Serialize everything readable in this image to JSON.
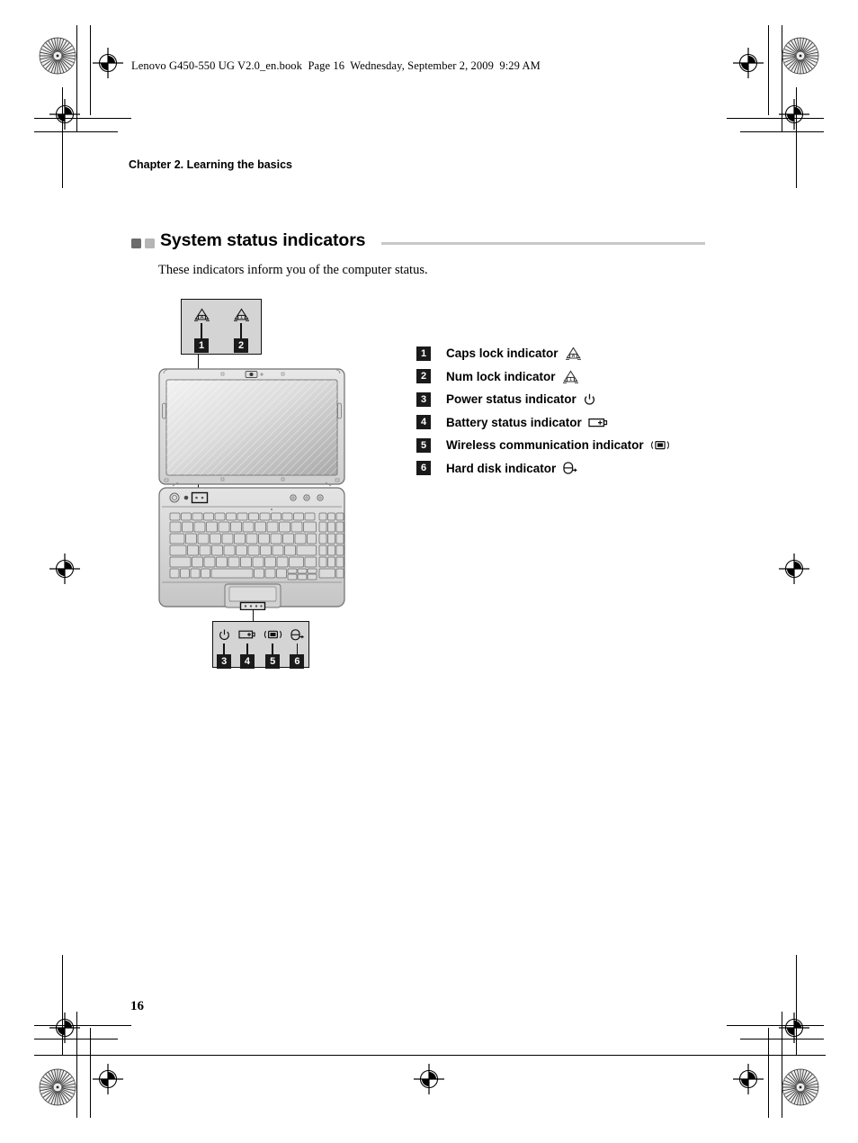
{
  "header": {
    "filename_line": "Lenovo G450-550 UG V2.0_en.book  Page 16  Wednesday, September 2, 2009  9:29 AM"
  },
  "chapter": {
    "title": "Chapter 2. Learning the basics"
  },
  "section": {
    "title": "System status indicators",
    "intro": "These indicators inform you of the computer status.",
    "bullet_dark_color": "#6b6b6b",
    "bullet_light_color": "#b5b5b5",
    "rule_color": "#c8c8c8"
  },
  "legend": {
    "items": [
      {
        "number": "1",
        "label": "Caps lock indicator",
        "icon": "caps-lock-icon"
      },
      {
        "number": "2",
        "label": "Num lock indicator",
        "icon": "num-lock-icon"
      },
      {
        "number": "3",
        "label": "Power status indicator",
        "icon": "power-icon"
      },
      {
        "number": "4",
        "label": "Battery status indicator",
        "icon": "battery-icon"
      },
      {
        "number": "5",
        "label": "Wireless communication indicator",
        "icon": "wireless-icon"
      },
      {
        "number": "6",
        "label": "Hard disk indicator",
        "icon": "hard-disk-icon"
      }
    ]
  },
  "callout_top": {
    "items": [
      {
        "number": "1",
        "icon": "caps-lock-icon"
      },
      {
        "number": "2",
        "icon": "num-lock-icon"
      }
    ]
  },
  "callout_bottom": {
    "items": [
      {
        "number": "3",
        "icon": "power-icon"
      },
      {
        "number": "4",
        "icon": "battery-icon"
      },
      {
        "number": "5",
        "icon": "wireless-icon"
      },
      {
        "number": "6",
        "icon": "hard-disk-icon"
      }
    ]
  },
  "illustration": {
    "name": "laptop-top-view-diagram"
  },
  "footer": {
    "page_number": "16"
  }
}
